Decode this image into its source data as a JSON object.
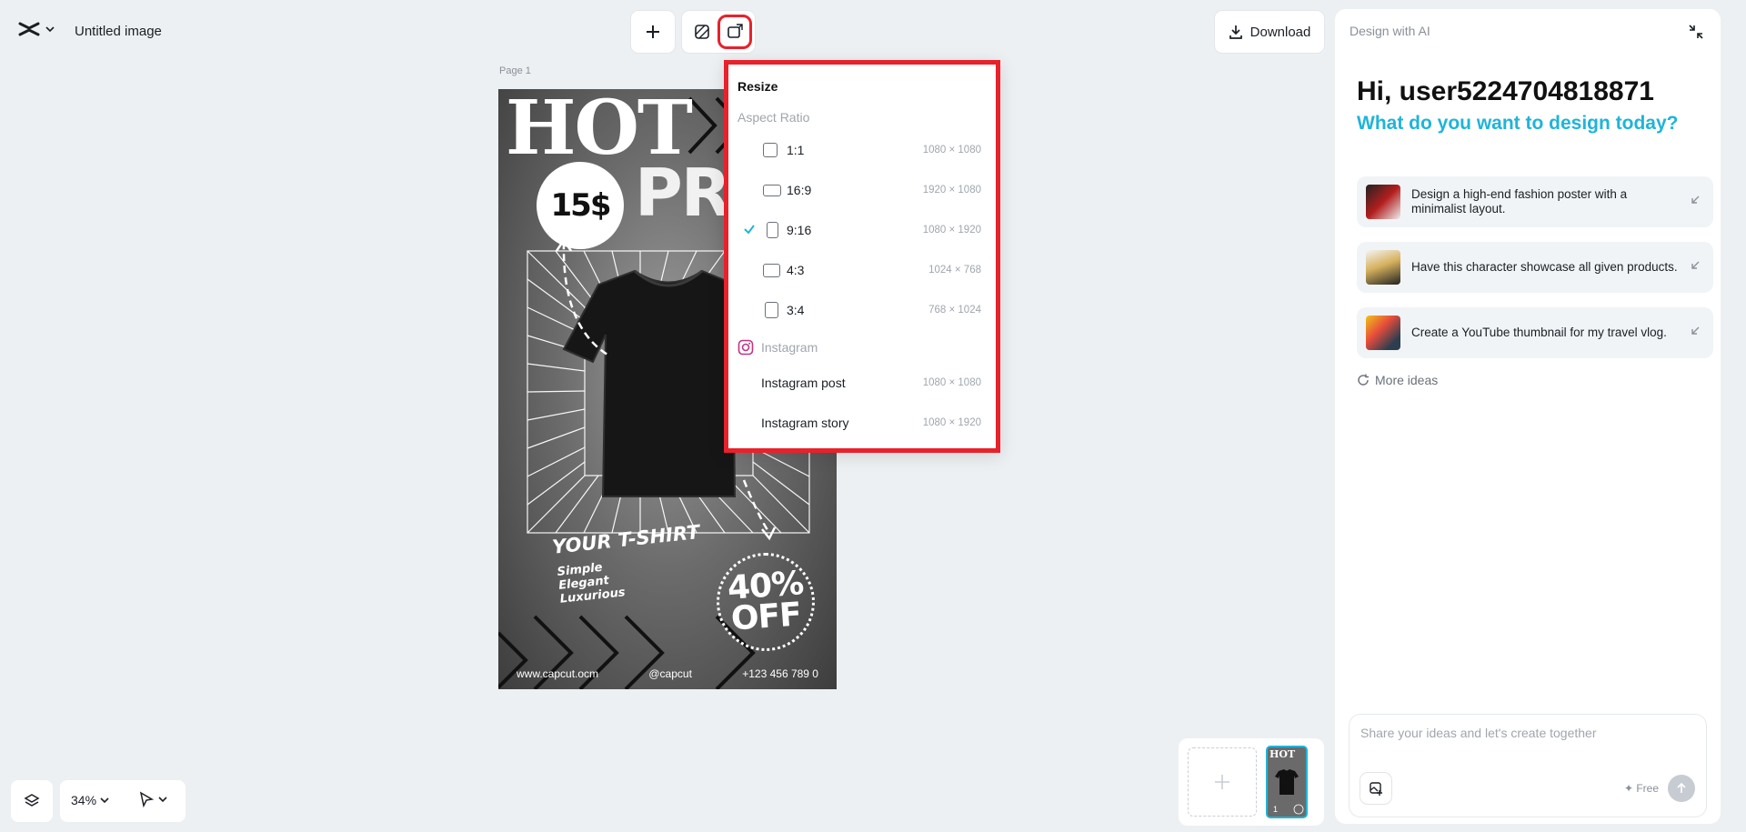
{
  "app": {
    "document_title": "Untitled image"
  },
  "toolbar": {
    "download_label": "Download"
  },
  "canvas": {
    "page_label": "Page 1",
    "poster": {
      "headline_1": "HOT",
      "headline_2": "PROMO",
      "price": "15$",
      "tagline": "YOUR T-SHIRT",
      "words": [
        "Simple",
        "Elegant",
        "Luxurious"
      ],
      "discount_1": "40%",
      "discount_2": "OFF",
      "footer": [
        "www.capcut.ocm",
        "@capcut",
        "+123 456 789 0"
      ]
    }
  },
  "resize_menu": {
    "title": "Resize",
    "aspect_section": "Aspect Ratio",
    "ratios": [
      {
        "label": "1:1",
        "dims": "1080 × 1080",
        "selected": false
      },
      {
        "label": "16:9",
        "dims": "1920 × 1080",
        "selected": false
      },
      {
        "label": "9:16",
        "dims": "1080 × 1920",
        "selected": true
      },
      {
        "label": "4:3",
        "dims": "1024 × 768",
        "selected": false
      },
      {
        "label": "3:4",
        "dims": "768 × 1024",
        "selected": false
      }
    ],
    "instagram_section": "Instagram",
    "instagram": [
      {
        "label": "Instagram post",
        "dims": "1080 × 1080"
      },
      {
        "label": "Instagram story",
        "dims": "1080 × 1920"
      }
    ]
  },
  "ai_panel": {
    "header": "Design with AI",
    "greeting": "Hi, user5224704818871",
    "subtitle": "What do you want to design today?",
    "ideas": [
      {
        "text": "Design a high-end fashion poster with a minimalist layout."
      },
      {
        "text": "Have this character showcase all given products."
      },
      {
        "text": "Create a YouTube thumbnail for my travel vlog."
      }
    ],
    "more_ideas": "More ideas",
    "chat_placeholder": "Share your ideas and let's create together",
    "free_label": "✦ Free"
  },
  "page_tray": {
    "thumb_page": "1"
  },
  "zoom": {
    "level": "34%"
  },
  "colors": {
    "accent": "#1fb4d9",
    "highlight": "#e8212b",
    "background": "#edf0f2"
  }
}
